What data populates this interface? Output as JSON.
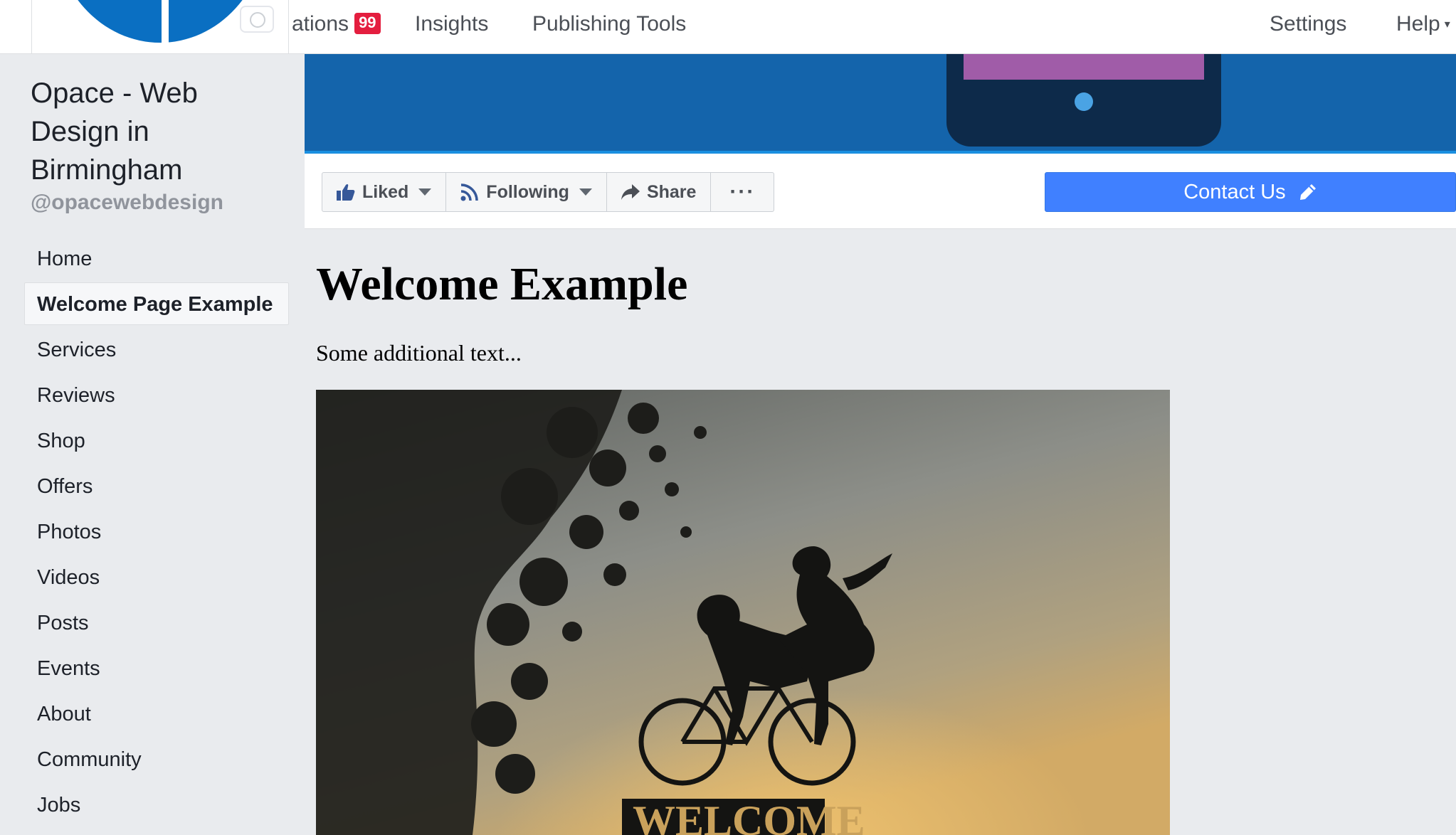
{
  "topbar": {
    "notifications_label": "ations",
    "notifications_count": "99",
    "insights_label": "Insights",
    "publishing_tools_label": "Publishing Tools",
    "settings_label": "Settings",
    "help_label": "Help",
    "help_caret": "▾"
  },
  "sidebar": {
    "page_name": "Opace - Web Design in Birmingham",
    "handle": "@opacewebdesign",
    "items": [
      {
        "label": "Home"
      },
      {
        "label": "Welcome Page Example"
      },
      {
        "label": "Services"
      },
      {
        "label": "Reviews"
      },
      {
        "label": "Shop"
      },
      {
        "label": "Offers"
      },
      {
        "label": "Photos"
      },
      {
        "label": "Videos"
      },
      {
        "label": "Posts"
      },
      {
        "label": "Events"
      },
      {
        "label": "About"
      },
      {
        "label": "Community"
      },
      {
        "label": "Jobs"
      }
    ],
    "active_item": "Welcome Page Example"
  },
  "actions": {
    "liked_label": "Liked",
    "following_label": "Following",
    "share_label": "Share",
    "more_label": "···",
    "contact_label": "Contact Us"
  },
  "main": {
    "title": "Welcome Example",
    "text": "Some additional text...",
    "image_sign_text": "WELCOME"
  },
  "colors": {
    "accent": "#4080ff",
    "cover_blue": "#1464ab",
    "badge_red": "#e41e3f",
    "page_background": "#e9ebee"
  },
  "icons": {
    "liked": "thumbs-up-icon",
    "following": "rss-icon",
    "share": "share-arrow-icon",
    "contact": "pencil-icon",
    "camera": "camera-icon"
  }
}
